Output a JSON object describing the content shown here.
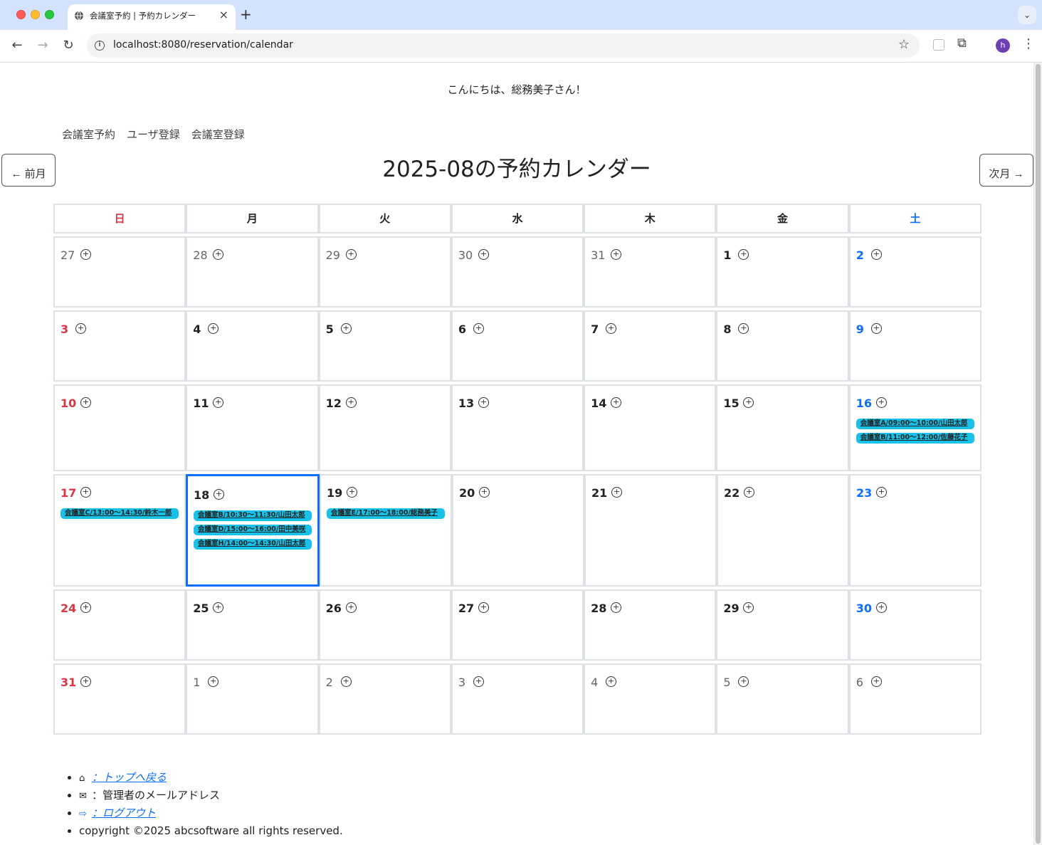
{
  "browser": {
    "tab_title": "会議室予約 | 予約カレンダー",
    "url": "localhost:8080/reservation/calendar",
    "avatar_letter": "h"
  },
  "greeting": "こんにちは、総務美子さん！",
  "menu": [
    "会議室予約",
    "ユーザ登録",
    "会議室登録"
  ],
  "prev_label": "← 前月",
  "next_label": "次月 →",
  "title": "2025-08の予約カレンダー",
  "weekdays": [
    "日",
    "月",
    "火",
    "水",
    "木",
    "金",
    "土"
  ],
  "weeks": [
    [
      {
        "d": "27",
        "cur": false,
        "ev": []
      },
      {
        "d": "28",
        "cur": false,
        "ev": []
      },
      {
        "d": "29",
        "cur": false,
        "ev": []
      },
      {
        "d": "30",
        "cur": false,
        "ev": []
      },
      {
        "d": "31",
        "cur": false,
        "ev": []
      },
      {
        "d": "1",
        "cur": true,
        "ev": []
      },
      {
        "d": "2",
        "cur": true,
        "ev": []
      }
    ],
    [
      {
        "d": "3",
        "cur": true,
        "ev": []
      },
      {
        "d": "4",
        "cur": true,
        "ev": []
      },
      {
        "d": "5",
        "cur": true,
        "ev": []
      },
      {
        "d": "6",
        "cur": true,
        "ev": []
      },
      {
        "d": "7",
        "cur": true,
        "ev": []
      },
      {
        "d": "8",
        "cur": true,
        "ev": []
      },
      {
        "d": "9",
        "cur": true,
        "ev": []
      }
    ],
    [
      {
        "d": "10",
        "cur": true,
        "ev": []
      },
      {
        "d": "11",
        "cur": true,
        "ev": []
      },
      {
        "d": "12",
        "cur": true,
        "ev": []
      },
      {
        "d": "13",
        "cur": true,
        "ev": []
      },
      {
        "d": "14",
        "cur": true,
        "ev": []
      },
      {
        "d": "15",
        "cur": true,
        "ev": []
      },
      {
        "d": "16",
        "cur": true,
        "ev": [
          "会議室A/09:00〜10:00/山田太郎",
          "会議室B/11:00〜12:00/佐藤花子"
        ]
      }
    ],
    [
      {
        "d": "17",
        "cur": true,
        "ev": [
          "会議室C/13:00〜14:30/鈴木一郎"
        ]
      },
      {
        "d": "18",
        "cur": true,
        "today": true,
        "ev": [
          "会議室B/10:30〜11:30/山田太郎",
          "会議室D/15:00〜16:00/田中美咲",
          "会議室H/14:00〜14:30/山田太郎"
        ]
      },
      {
        "d": "19",
        "cur": true,
        "ev": [
          "会議室E/17:00〜18:00/総務美子"
        ]
      },
      {
        "d": "20",
        "cur": true,
        "ev": []
      },
      {
        "d": "21",
        "cur": true,
        "ev": []
      },
      {
        "d": "22",
        "cur": true,
        "ev": []
      },
      {
        "d": "23",
        "cur": true,
        "ev": []
      }
    ],
    [
      {
        "d": "24",
        "cur": true,
        "ev": []
      },
      {
        "d": "25",
        "cur": true,
        "ev": []
      },
      {
        "d": "26",
        "cur": true,
        "ev": []
      },
      {
        "d": "27",
        "cur": true,
        "ev": []
      },
      {
        "d": "28",
        "cur": true,
        "ev": []
      },
      {
        "d": "29",
        "cur": true,
        "ev": []
      },
      {
        "d": "30",
        "cur": true,
        "ev": []
      }
    ],
    [
      {
        "d": "31",
        "cur": true,
        "ev": []
      },
      {
        "d": "1",
        "cur": false,
        "ev": []
      },
      {
        "d": "2",
        "cur": false,
        "ev": []
      },
      {
        "d": "3",
        "cur": false,
        "ev": []
      },
      {
        "d": "4",
        "cur": false,
        "ev": []
      },
      {
        "d": "5",
        "cur": false,
        "ev": []
      },
      {
        "d": "6",
        "cur": false,
        "ev": []
      }
    ]
  ],
  "footer": {
    "top_link": "：トップへ戻る",
    "admin_mail": "：管理者のメールアドレス",
    "logout": "：ログアウト",
    "copyright": "copyright ©2025 abcsoftware all rights reserved."
  },
  "colors": {
    "sunday": "#dc3545",
    "saturday": "#0d6efd",
    "event_bg": "#17c1e8",
    "today_border": "#0d6efd"
  }
}
